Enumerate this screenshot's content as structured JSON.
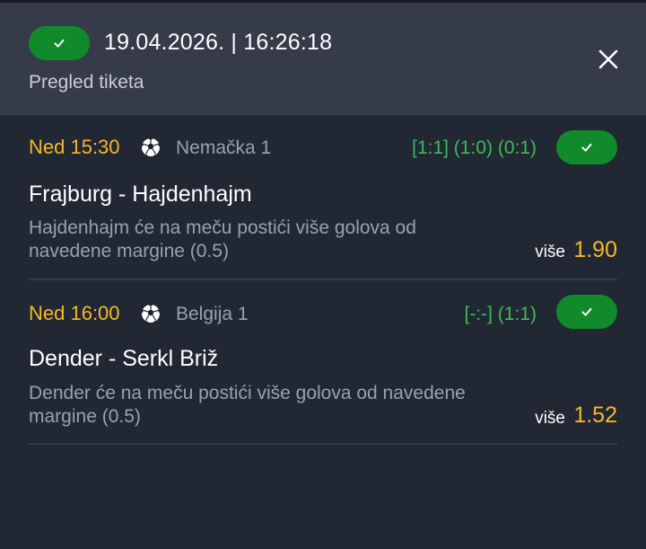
{
  "header": {
    "datetime": "19.04.2026. | 16:26:18",
    "subtitle": "Pregled tiketa",
    "status_icon": "check-icon",
    "close_icon": "close-icon"
  },
  "events": [
    {
      "time": "Ned 15:30",
      "sport_icon": "soccer-ball-icon",
      "league": "Nemačka 1",
      "score": "[1:1] (1:0) (0:1)",
      "match": "Frajburg - Hajdenhajm",
      "market": "Hajdenhajm će na meču postići više golova od navedene margine (0.5)",
      "pick": "više",
      "odds": "1.90"
    },
    {
      "time": "Ned 16:00",
      "sport_icon": "soccer-ball-icon",
      "league": "Belgija 1",
      "score": "[-:-] (1:1)",
      "match": "Dender - Serkl Briž",
      "market": "Dender će na meču postići više golova od navedene margine (0.5)",
      "pick": "više",
      "odds": "1.52"
    }
  ],
  "colors": {
    "background": "#212733",
    "header_bg": "#353b48",
    "accent_green": "#118a2b",
    "score_green": "#3dbb5b",
    "odds_yellow": "#f5b82a",
    "muted_text": "#9aa1ad"
  }
}
